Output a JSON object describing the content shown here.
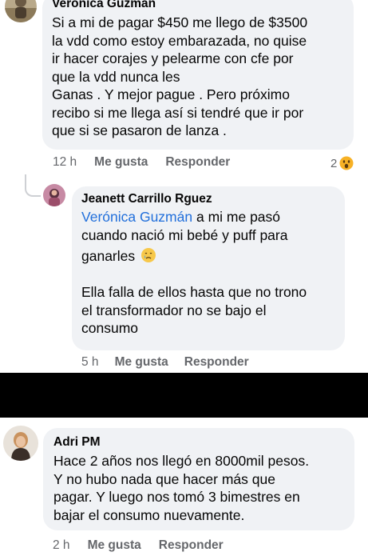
{
  "comments": [
    {
      "author": "Verónica Guzmán",
      "lines": [
        "Si a mi de pagar $450 me llego de $3500",
        "la vdd como estoy embarazada, no quise",
        "ir hacer corajes y pelearme con cfe por",
        "que la vdd nunca les",
        "Ganas . Y mejor pague . Pero próximo",
        "recibo si me llega así si tendré que ir por",
        "que si se pasaron de lanza ."
      ],
      "time": "12 h",
      "like_label": "Me gusta",
      "reply_label": "Responder",
      "reaction_count": "2",
      "reaction_icon": "wow-reaction-icon"
    },
    {
      "author": "Jeanett Carrillo Rguez",
      "mention": "Verónica Guzmán",
      "lines": [
        " a mi me pasó",
        "cuando nació mi bebé y puff para",
        "ganarles",
        "Ella falla de ellos hasta que no trono",
        "el transformador no se bajo el",
        "consumo"
      ],
      "emoji": "sad-tear-emoji",
      "time": "5 h",
      "like_label": "Me gusta",
      "reply_label": "Responder"
    },
    {
      "author": "Adri PM",
      "lines": [
        "Hace 2 años nos llegó en 8000mil pesos.",
        "Y no hubo nada que hacer más que",
        "pagar. Y luego nos tomó 3 bimestres en",
        "bajar el consumo nuevamente."
      ],
      "time": "2 h",
      "like_label": "Me gusta",
      "reply_label": "Responder"
    }
  ],
  "colors": {
    "bubble": "#f0f2f5",
    "meta_text": "#65676b",
    "mention": "#216fdb",
    "redaction": "#000000"
  }
}
